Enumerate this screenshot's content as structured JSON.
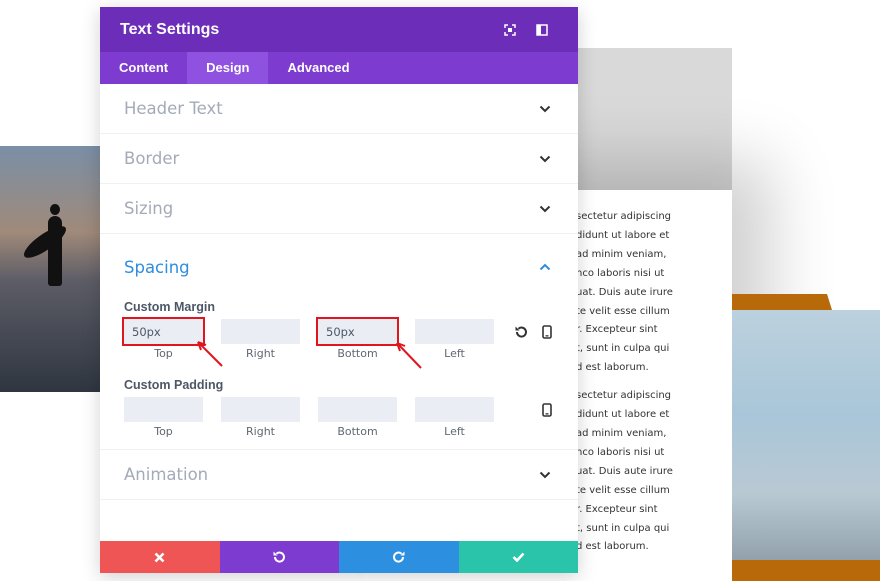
{
  "background": {
    "paragraphs": [
      [
        "sectetur adipiscing",
        "didunt ut labore et",
        "ad minim veniam,",
        "nco laboris nisi ut",
        "uat. Duis aute irure",
        "te velit esse cillum",
        "r. Excepteur sint",
        "t, sunt in culpa qui",
        "d est laborum."
      ],
      [
        "sectetur adipiscing",
        "didunt ut labore et",
        "ad minim veniam,",
        "nco laboris nisi ut",
        "uat. Duis aute irure",
        "te velit esse cillum",
        "r. Excepteur sint",
        "t, sunt in culpa qui",
        "d est laborum."
      ]
    ]
  },
  "modal": {
    "title": "Text Settings",
    "header_icons": [
      "expand-icon",
      "sidebar-toggle-icon"
    ],
    "tabs": [
      {
        "label": "Content",
        "active": false
      },
      {
        "label": "Design",
        "active": true
      },
      {
        "label": "Advanced",
        "active": false
      }
    ],
    "sections_top": [
      {
        "title": "Header Text"
      },
      {
        "title": "Border"
      },
      {
        "title": "Sizing"
      }
    ],
    "spacing": {
      "title": "Spacing",
      "custom_margin": {
        "label": "Custom Margin",
        "top": {
          "value": "50px",
          "label": "Top"
        },
        "right": {
          "value": "",
          "label": "Right"
        },
        "bottom": {
          "value": "50px",
          "label": "Bottom"
        },
        "left": {
          "value": "",
          "label": "Left"
        }
      },
      "custom_padding": {
        "label": "Custom Padding",
        "top": {
          "value": "",
          "label": "Top"
        },
        "right": {
          "value": "",
          "label": "Right"
        },
        "bottom": {
          "value": "",
          "label": "Bottom"
        },
        "left": {
          "value": "",
          "label": "Left"
        }
      }
    },
    "sections_bottom": [
      {
        "title": "Animation"
      }
    ],
    "footer_icons": [
      "close-icon",
      "undo-icon",
      "redo-icon",
      "check-icon"
    ],
    "colors": {
      "header": "#6c2eb9",
      "tabs": "#7e3bd0",
      "active_tab": "#8f51e0",
      "accent_blue": "#2e8de0",
      "cancel": "#ef5555",
      "undo": "#7e3bd0",
      "redo": "#2d8fe0",
      "save": "#29c4a9",
      "highlight": "#e0161e"
    }
  }
}
